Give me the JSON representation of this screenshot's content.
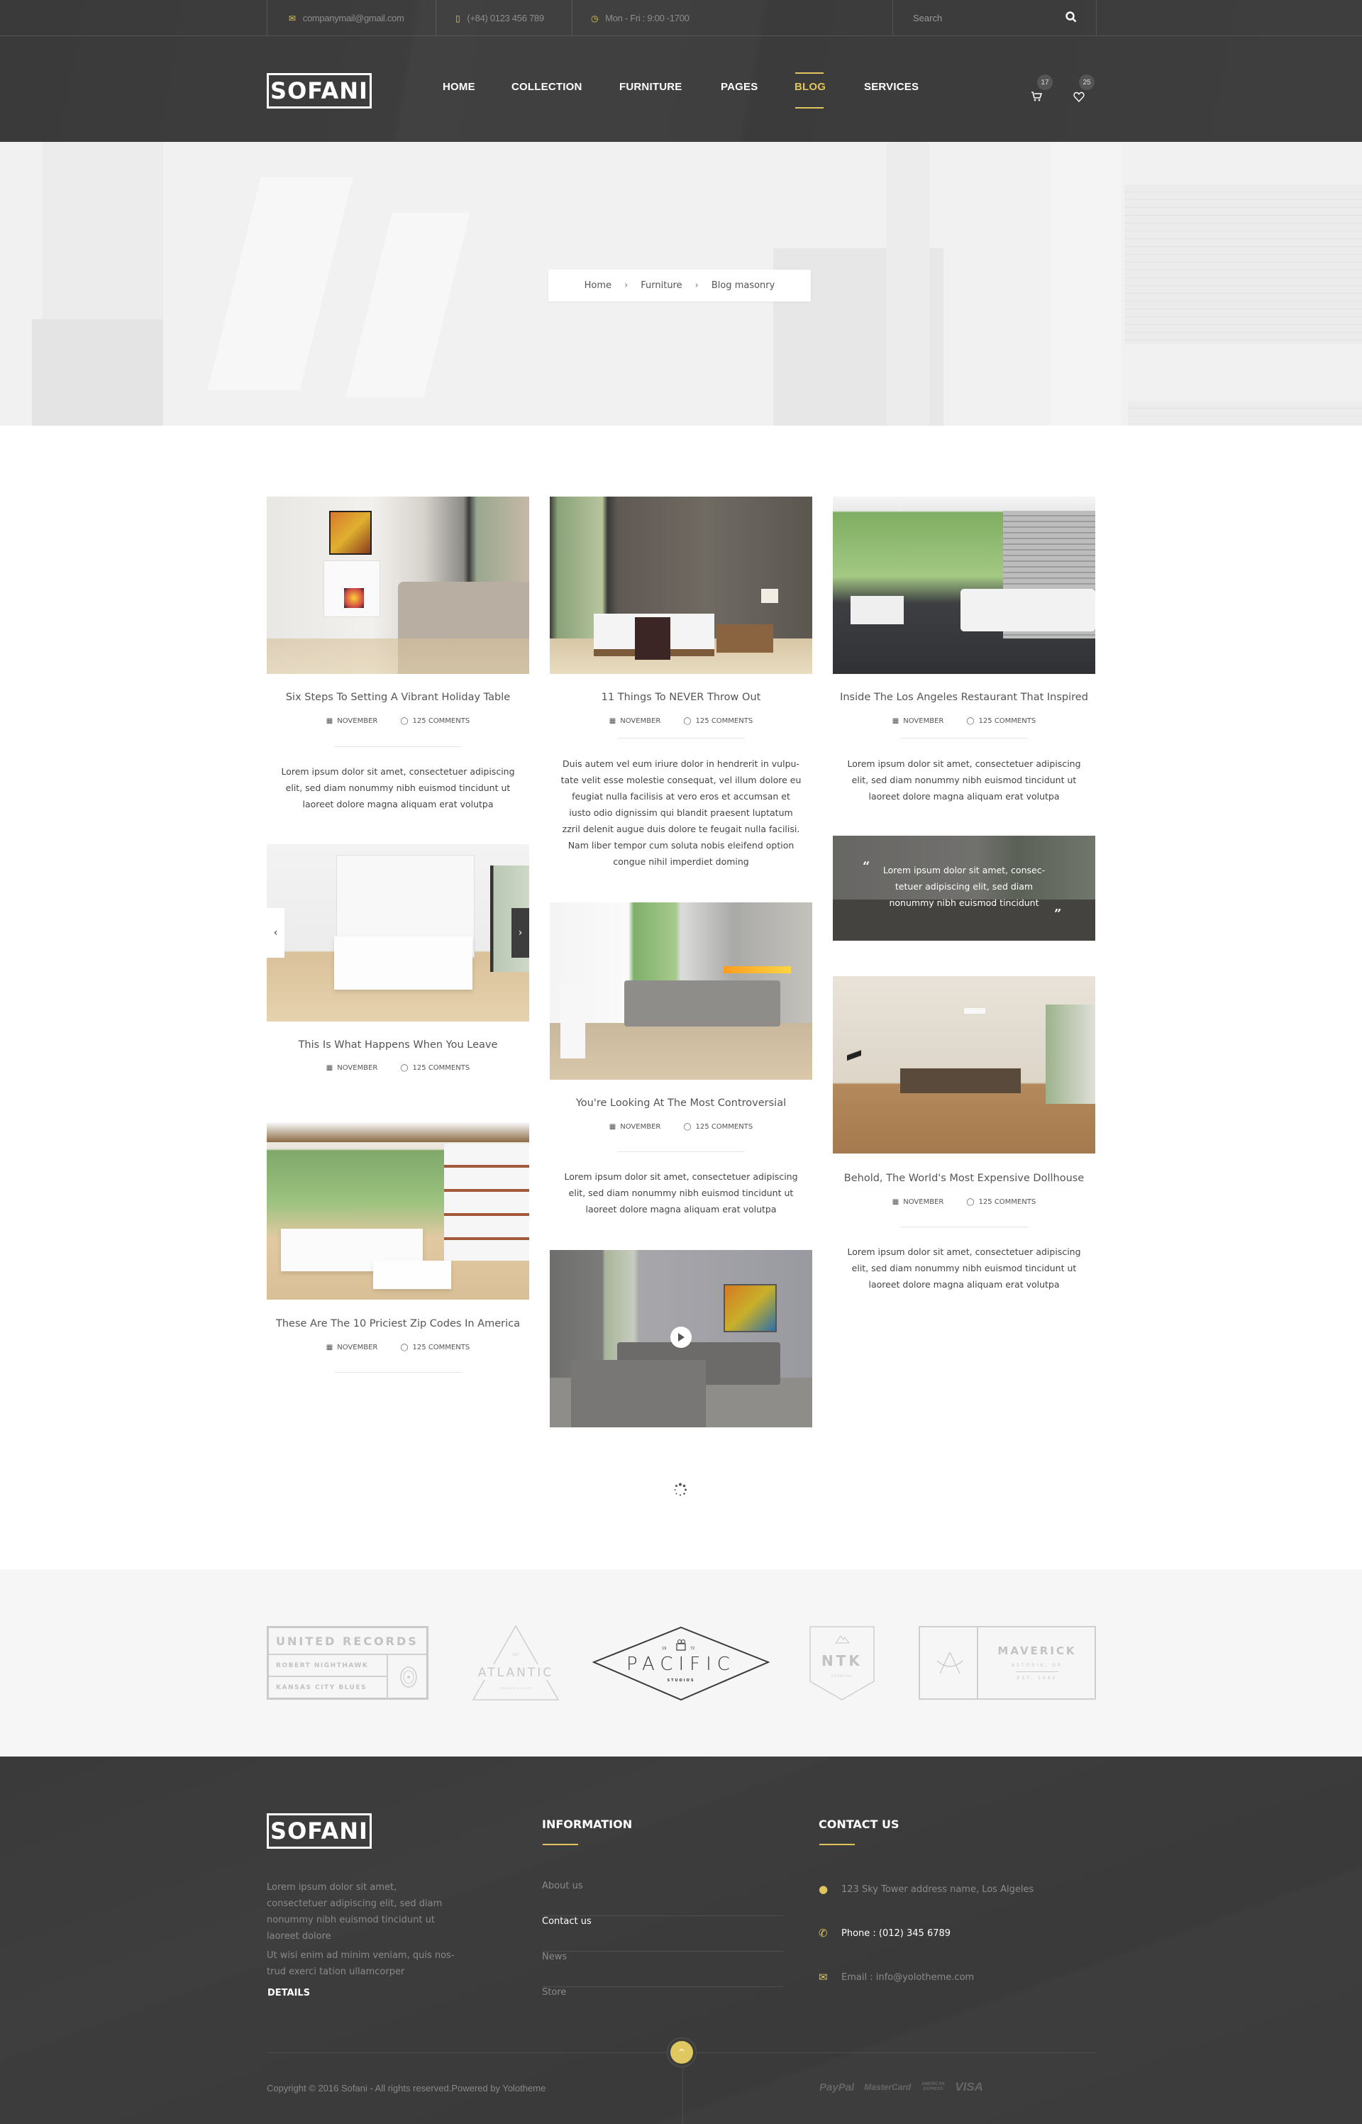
{
  "topbar": {
    "email": "companymail@gmail.com",
    "phone": "(+84) 0123 456 789",
    "hours": "Mon - Fri : 9:00 -1700",
    "search_placeholder": "Search"
  },
  "header": {
    "logo": "SOFANI",
    "nav": [
      {
        "label": "HOME"
      },
      {
        "label": "COLLECTION"
      },
      {
        "label": "FURNITURE"
      },
      {
        "label": "PAGES"
      },
      {
        "label": "BLOG",
        "active": true
      },
      {
        "label": "SERVICES"
      }
    ],
    "cart_count": "17",
    "wishlist_count": "25"
  },
  "breadcrumb": [
    "Home",
    "Furniture",
    "Blog masonry"
  ],
  "colors": {
    "accent": "#e2c45d",
    "dark": "#3d3d3d"
  },
  "posts": [
    {
      "title": "Six Steps To Setting A Vibrant Holiday Table",
      "date": "NOVEMBER",
      "comments": "125 COMMENTS",
      "excerpt": "Lorem ipsum dolor sit amet, consectetuer adipiscing elit, sed diam nonummy nibh euismod tincidunt ut laoreet dolore magna aliquam erat volutpa"
    },
    {
      "title": "11 Things To NEVER Throw Out",
      "date": "NOVEMBER",
      "comments": "125 COMMENTS",
      "excerpt": "Duis autem vel eum iriure dolor in hendrerit in vulpu-tate velit esse molestie consequat, vel illum dolore eu feugiat nulla facilisis at vero eros et accumsan et iusto odio dignissim qui blandit praesent luptatum zzril delenit augue duis dolore te feugait nulla facilisi. Nam liber tempor cum soluta nobis eleifend option congue nihil imperdiet doming"
    },
    {
      "title": "Inside The Los Angeles Restaurant That Inspired",
      "date": "NOVEMBER",
      "comments": "125 COMMENTS",
      "excerpt": "Lorem ipsum dolor sit amet, consectetuer adipiscing elit, sed diam nonummy nibh euismod tincidunt ut laoreet dolore magna aliquam erat volutpa"
    },
    {
      "title": "This Is What Happens When You Leave",
      "date": "NOVEMBER",
      "comments": "125 COMMENTS"
    },
    {
      "title": "You're Looking At The Most Controversial",
      "date": "NOVEMBER",
      "comments": "125 COMMENTS",
      "excerpt": "Lorem ipsum dolor sit amet, consectetuer adipiscing elit, sed diam nonummy nibh euismod tincidunt ut laoreet dolore magna aliquam erat volutpa"
    },
    {
      "title": "Behold, The World's Most Expensive Dollhouse",
      "date": "NOVEMBER",
      "comments": "125 COMMENTS",
      "excerpt": "Lorem ipsum dolor sit amet, consectetuer adipiscing elit, sed diam nonummy nibh euismod tincidunt ut laoreet dolore magna aliquam erat volutpa"
    },
    {
      "title": "These Are The 10 Priciest Zip Codes In America",
      "date": "NOVEMBER",
      "comments": "125 COMMENTS"
    }
  ],
  "quote_post": {
    "text": "Lorem ipsum dolor sit amet, consec-tetuer adipiscing elit, sed diam nonummy nibh euismod tincidunt"
  },
  "partners": {
    "united": {
      "title": "UNITED RECORDS",
      "line1": "ROBERT NIGHTHAWK",
      "line2": "KANSAS CITY BLUES"
    },
    "atlantic": {
      "est": "1957",
      "name": "ATLANTIC",
      "sub": "PREMIUM QUALITY"
    },
    "pacific": {
      "y1": "19",
      "y2": "72",
      "name": "PACIFIC",
      "sub": "STUDIOS"
    },
    "ntk": {
      "name": "NTK",
      "sub": "VERMONT"
    },
    "maverick": {
      "name": "MAVERICK",
      "loc": "ASTORIA, OR",
      "est": "EST. 1982"
    }
  },
  "footer": {
    "logo": "SOFANI",
    "about1": "Lorem ipsum dolor sit amet, consectetuer adipiscing elit, sed diam nonummy nibh euismod tincidunt ut laoreet dolore",
    "about2": "Ut wisi enim ad minim veniam, quis nos-trud exerci tation ullamcorper",
    "details": "DETAILS",
    "info_title": "INFORMATION",
    "info_links": [
      "About us",
      "Contact us",
      "News",
      "Store"
    ],
    "contact_title": "CONTACT US",
    "address": "123 Sky Tower address name, Los Algeles",
    "phone": "Phone : (012) 345 6789",
    "email": "Email : info@yolotheme.com",
    "copyright": "Copyright © 2016 Sofani - All rights reserved.Powered by Yolotheme",
    "payments": [
      "PayPal",
      "MasterCard",
      "AMERICAN EXPRESS",
      "VISA"
    ]
  }
}
